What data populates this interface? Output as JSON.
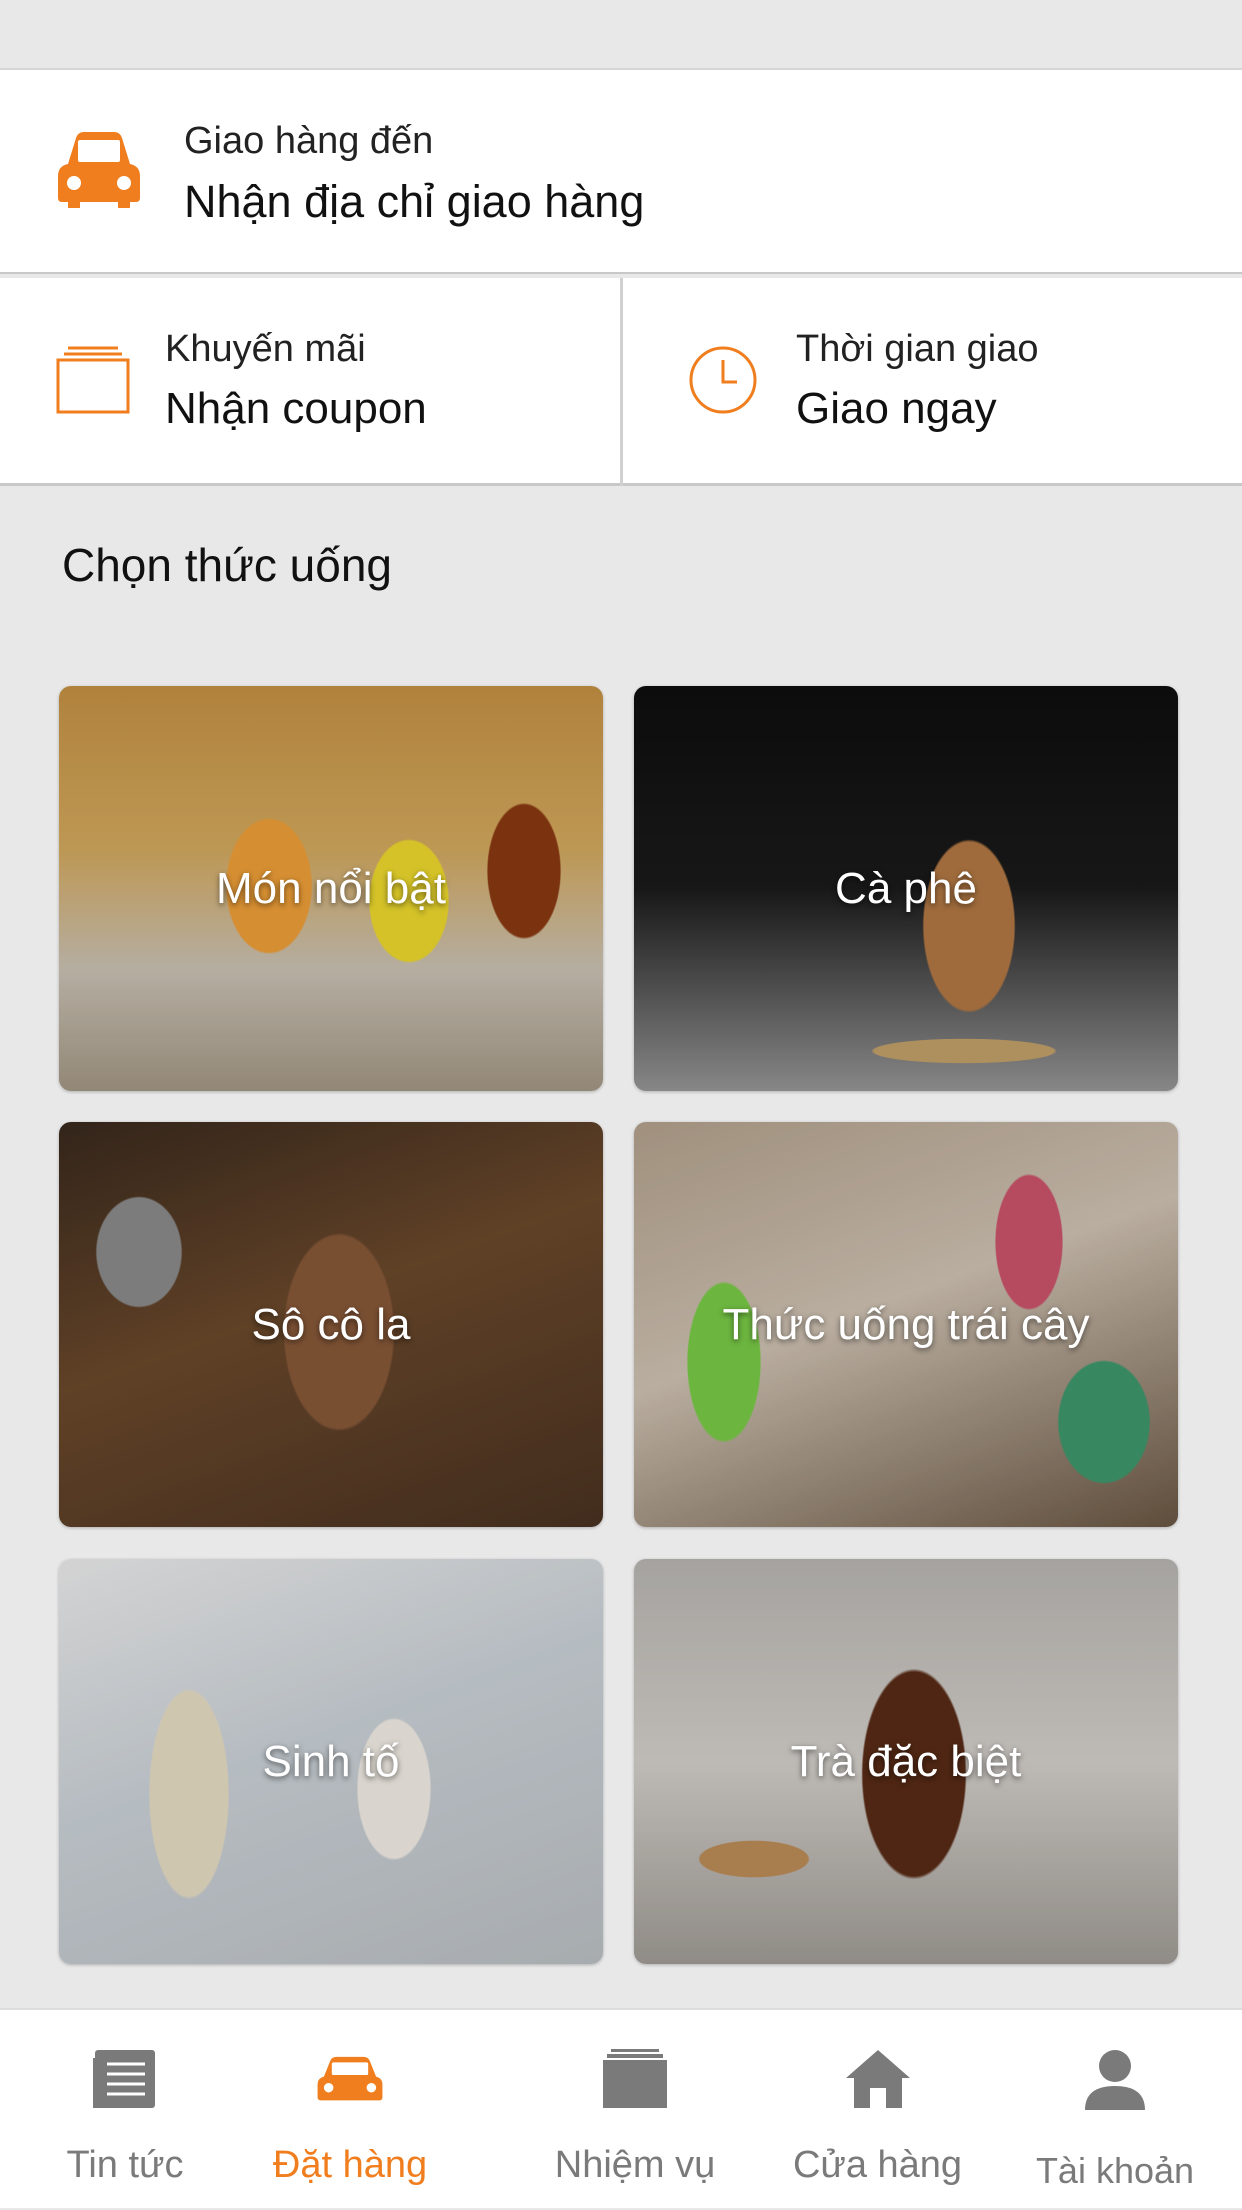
{
  "colors": {
    "accent": "#f07e1e",
    "inactive": "#7a7a7a",
    "background": "#e8e8e8"
  },
  "delivery": {
    "label": "Giao hàng đến",
    "value": "Nhận địa chỉ giao hàng",
    "icon": "car-icon"
  },
  "promo": {
    "label": "Khuyến mãi",
    "value": "Nhận coupon",
    "icon": "coupon-icon"
  },
  "time": {
    "label": "Thời gian giao",
    "value": "Giao ngay",
    "icon": "clock-icon"
  },
  "section": {
    "title": "Chọn thức uống"
  },
  "categories": [
    {
      "label": "Món nổi bật"
    },
    {
      "label": "Cà phê"
    },
    {
      "label": "Sô cô la"
    },
    {
      "label": "Thức uống trái cây"
    },
    {
      "label": "Sinh tố"
    },
    {
      "label": "Trà đặc biệt"
    }
  ],
  "nav": [
    {
      "label": "Tin tức",
      "icon": "news-icon",
      "active": false
    },
    {
      "label": "Đặt hàng",
      "icon": "car-icon",
      "active": true
    },
    {
      "label": "Nhiệm vụ",
      "icon": "tasks-icon",
      "active": false
    },
    {
      "label": "Cửa hàng",
      "icon": "store-icon",
      "active": false
    },
    {
      "label": "Tài khoản",
      "icon": "account-icon",
      "active": false
    }
  ]
}
